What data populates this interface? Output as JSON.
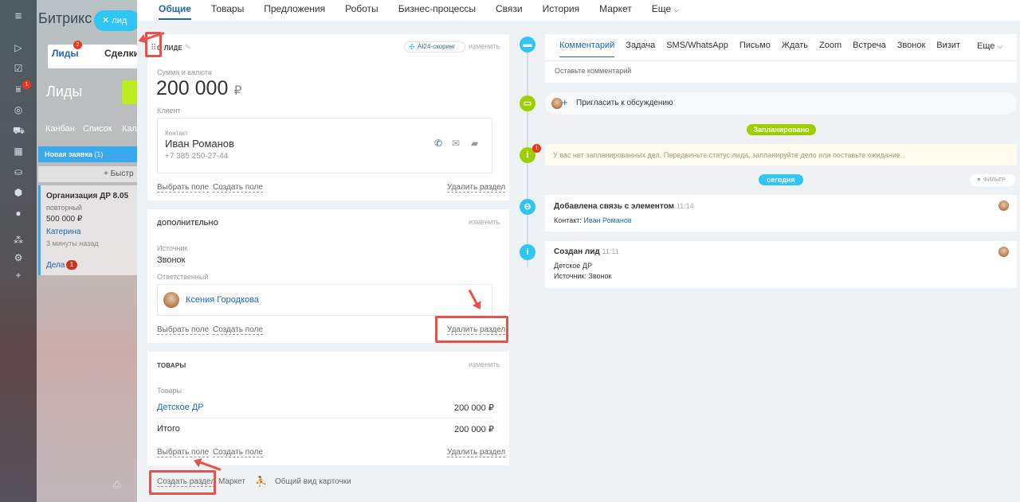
{
  "background": {
    "app_name": "Битрикс",
    "close_chip_label": "лид",
    "tabs": [
      "Лиды",
      "Сделки"
    ],
    "leads_badge": "2",
    "menu_badge": "1",
    "page_title": "Лиды",
    "view_modes": [
      "Канбан",
      "Список",
      "Кал"
    ],
    "column_header": "Новая заявка",
    "column_count": "(1)",
    "quick_add": "+ Быстр",
    "lead_card": {
      "title": "Организация ДР 8.05",
      "status": "повторный",
      "amount": "500 000 ₽",
      "person": "Катерина",
      "time": "3 минуты назад",
      "deals_label": "Дела",
      "deals_count": "1"
    }
  },
  "tabs": [
    {
      "label": "Общие",
      "active": true
    },
    {
      "label": "Товары"
    },
    {
      "label": "Предложения"
    },
    {
      "label": "Роботы"
    },
    {
      "label": "Бизнес-процессы"
    },
    {
      "label": "Связи"
    },
    {
      "label": "История"
    },
    {
      "label": "Маркет"
    },
    {
      "label": "Еще"
    }
  ],
  "about": {
    "title": "О ЛИДЕ",
    "scoring_label": "AI24-скоринг",
    "edit_label": "изменить",
    "amount_label": "Сумма и валюта",
    "amount_value": "200 000",
    "currency": "₽",
    "client_label": "Клиент",
    "contact_label": "Контакт",
    "contact_name": "Иван Романов",
    "contact_phone": "+7 385 250-27-44",
    "select_field": "Выбрать поле",
    "create_field": "Создать поле",
    "delete_section": "Удалить раздел"
  },
  "extra": {
    "title": "ДОПОЛНИТЕЛЬНО",
    "edit_label": "изменить",
    "source_label": "Источник",
    "source_value": "Звонок",
    "responsible_label": "Ответственный",
    "responsible_name": "Ксения Городкова",
    "select_field": "Выбрать поле",
    "create_field": "Создать поле",
    "delete_section": "Удалить раздел"
  },
  "products": {
    "title": "ТОВАРЫ",
    "edit_label": "изменить",
    "products_label": "Товары",
    "item_name": "Детское ДР",
    "item_price": "200 000 ₽",
    "total_label": "Итого",
    "total_value": "200 000 ₽",
    "select_field": "Выбрать поле",
    "create_field": "Создать поле",
    "delete_section": "Удалить раздел"
  },
  "bottom": {
    "create_section": "Создать раздел",
    "market": "Маркет",
    "card_view": "Общий вид карточки"
  },
  "timeline": {
    "tabs": [
      "Комментарий",
      "Задача",
      "SMS/WhatsApp",
      "Письмо",
      "Ждать",
      "Zoom",
      "Встреча",
      "Звонок",
      "Визит"
    ],
    "more": "Еще",
    "comment_placeholder": "Оставьте комментарий",
    "invite": "Пригласить к обсуждению",
    "planned_pill": "Запланировано",
    "planned_badge": "1",
    "planned_text": "У вас нет запланированных дел. Передвиньте статус лида, запланируйте дело или поставьте ожидание.",
    "today_pill": "сегодня",
    "filter": "ФИЛЬТР",
    "event1": {
      "title": "Добавлена связь с элементом",
      "time": "11:14",
      "label": "Контакт:",
      "link": "Иван Романов"
    },
    "event2": {
      "title": "Создан лид",
      "time": "11:11",
      "line1": "Детское ДР",
      "line2": "Источник: Звонок"
    }
  },
  "colors": {
    "accent": "#2067b0",
    "timeline_blue": "#2fc6f6",
    "green": "#9dcf00",
    "highlight_red": "#e8524a"
  }
}
